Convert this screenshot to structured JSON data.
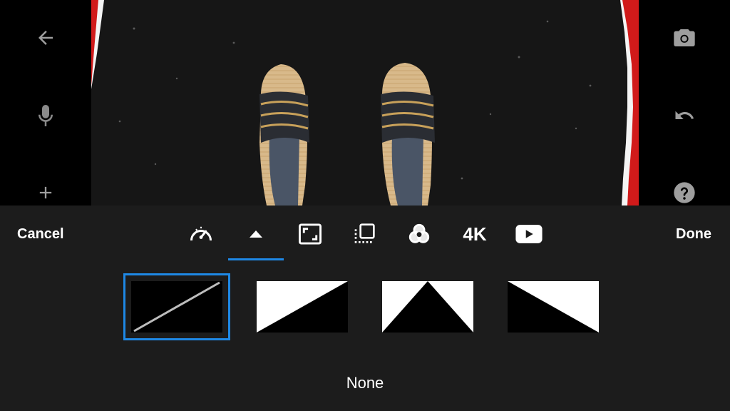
{
  "toolbar": {
    "cancel_label": "Cancel",
    "done_label": "Done",
    "tools": [
      {
        "name": "speed",
        "icon": "speedometer-icon"
      },
      {
        "name": "transition",
        "icon": "triangle-up-icon",
        "active": true
      },
      {
        "name": "crop",
        "icon": "crop-frame-icon"
      },
      {
        "name": "layers",
        "icon": "layers-icon"
      },
      {
        "name": "filters",
        "icon": "color-circles-icon"
      },
      {
        "name": "quality",
        "label": "4K"
      },
      {
        "name": "youtube",
        "icon": "youtube-play-icon"
      }
    ],
    "quality_label": "4K"
  },
  "left_rail": [
    "back-arrow-icon",
    "microphone-icon",
    "plus-icon"
  ],
  "right_rail": [
    "camera-icon",
    "undo-icon",
    "help-icon"
  ],
  "transitions": {
    "selected_index": 0,
    "selected_name": "None",
    "items": [
      {
        "icon": "none-diagonal-icon"
      },
      {
        "icon": "wipe-diagonal-icon"
      },
      {
        "icon": "triangle-peak-icon"
      },
      {
        "icon": "wipe-reverse-icon"
      }
    ]
  },
  "colors": {
    "accent": "#1e88e5",
    "panel_bg": "#1c1c1c",
    "preview_border": "#d11a1a"
  }
}
